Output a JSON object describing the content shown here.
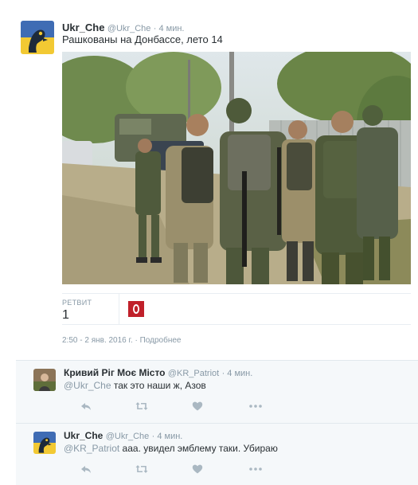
{
  "tweet": {
    "author_name": "Ukr_Che",
    "author_handle": "@Ukr_Che",
    "time": "· 4 мин.",
    "text": "Рашкованы на Донбассе, лето 14",
    "retweets_label": "РЕТВИТ",
    "retweets_count": "1",
    "timestamp": "2:50 - 2 янв. 2016 г.",
    "details_link": "· Подробнее"
  },
  "replies": [
    {
      "author_name": "Кривий Ріг Моє Місто",
      "author_handle": "@KR_Patriot",
      "time": "· 4 мин.",
      "mention": "@Ukr_Che",
      "text": " так это наши ж, Азов"
    },
    {
      "author_name": "Ukr_Che",
      "author_handle": "@Ukr_Che",
      "time": "· 4 мин.",
      "mention": "@KR_Patriot",
      "text": " ааа. увидел эмблему таки. Убираю"
    }
  ],
  "icons": {
    "reply": "reply-arrow-icon",
    "retweet": "retweet-icon",
    "like": "heart-icon",
    "more": "more-dots-icon"
  },
  "colors": {
    "text": "#292f33",
    "muted": "#8899a6",
    "reply_bg": "#f5f8fa",
    "action_icon": "#aab8c2",
    "retweeter_avatar": "#c0202a"
  }
}
